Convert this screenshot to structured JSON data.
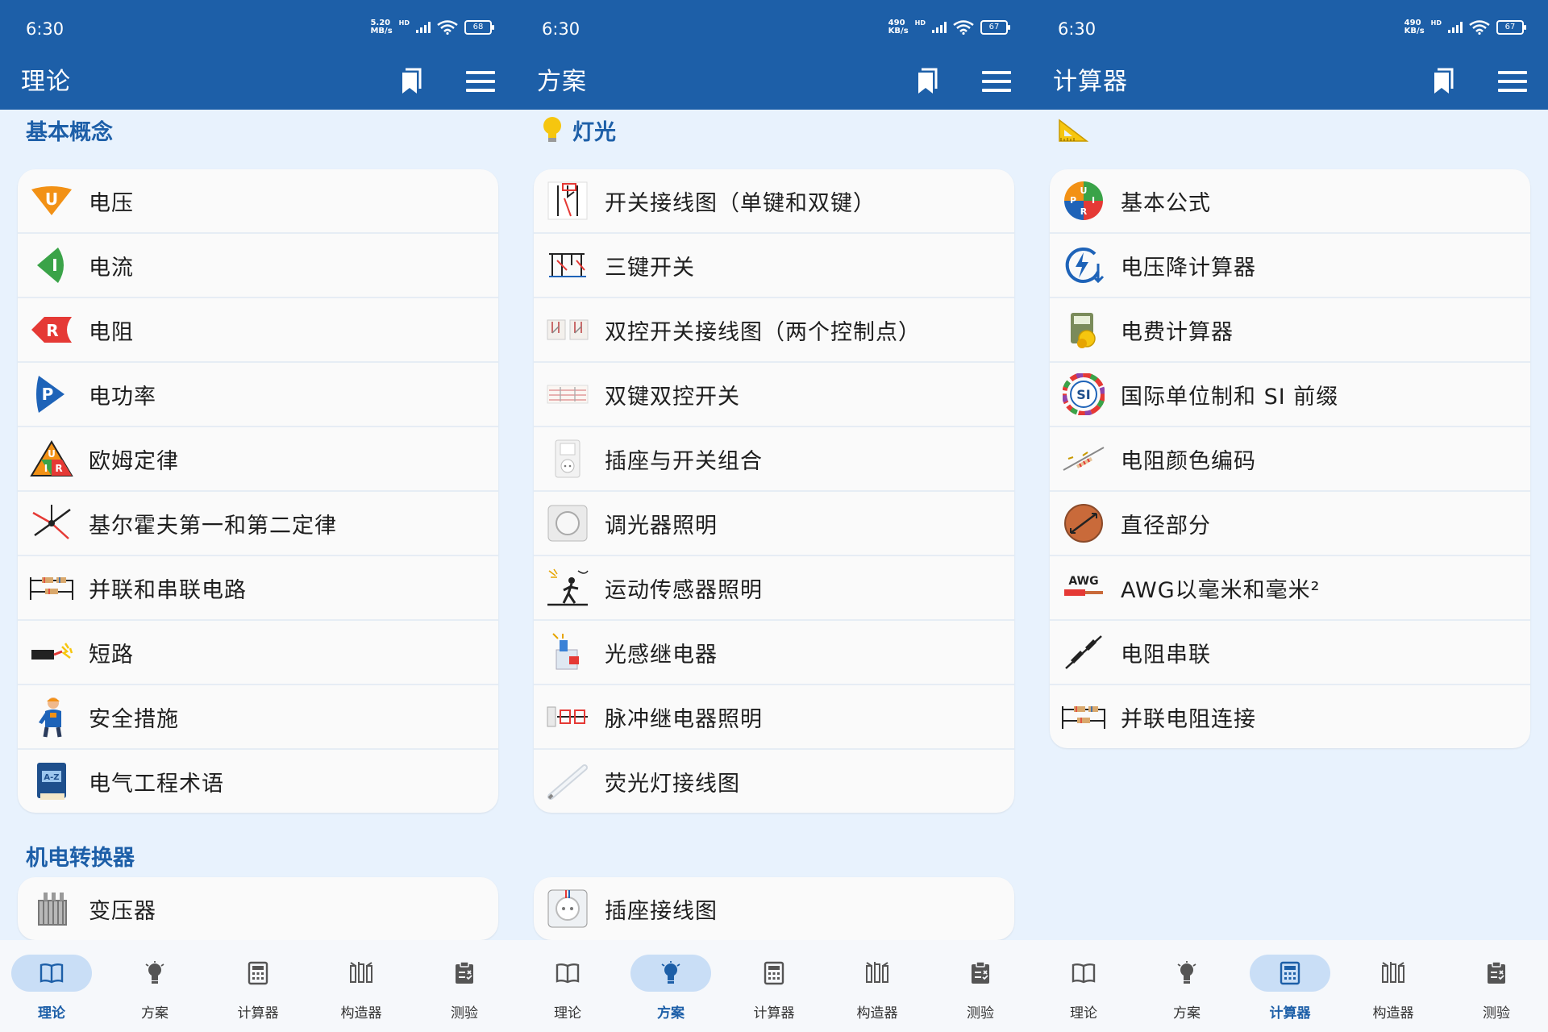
{
  "status": {
    "time": "6:30"
  },
  "screens": [
    {
      "speed": [
        "5.20",
        "MB/s"
      ],
      "battery": "68",
      "title": "理论",
      "sections": [
        {
          "title": "基本概念",
          "icon": "",
          "items": [
            {
              "label": "电压",
              "icon": "voltage-u-icon"
            },
            {
              "label": "电流",
              "icon": "current-i-icon"
            },
            {
              "label": "电阻",
              "icon": "resistance-r-icon"
            },
            {
              "label": "电功率",
              "icon": "power-p-icon"
            },
            {
              "label": "欧姆定律",
              "icon": "ohms-law-triangle-icon"
            },
            {
              "label": "基尔霍夫第一和第二定律",
              "icon": "kirchhoff-node-icon"
            },
            {
              "label": "并联和串联电路",
              "icon": "parallel-series-circuit-icon"
            },
            {
              "label": "短路",
              "icon": "short-circuit-spark-icon"
            },
            {
              "label": "安全措施",
              "icon": "electrician-worker-icon"
            },
            {
              "label": "电气工程术语",
              "icon": "az-book-icon"
            }
          ]
        },
        {
          "title": "机电转换器",
          "icon": "",
          "items": [
            {
              "label": "变压器",
              "icon": "transformer-icon"
            }
          ]
        }
      ]
    },
    {
      "speed": [
        "490",
        "KB/s"
      ],
      "battery": "67",
      "title": "方案",
      "sections": [
        {
          "title": "灯光",
          "icon": "lightbulb-icon",
          "items": [
            {
              "label": "开关接线图（单键和双键）",
              "icon": "switch-wiring-icon"
            },
            {
              "label": "三键开关",
              "icon": "three-gang-switch-icon"
            },
            {
              "label": "双控开关接线图（两个控制点）",
              "icon": "two-way-switch-icon"
            },
            {
              "label": "双键双控开关",
              "icon": "double-two-way-switch-icon"
            },
            {
              "label": "插座与开关组合",
              "icon": "socket-switch-combo-icon"
            },
            {
              "label": "调光器照明",
              "icon": "dimmer-icon"
            },
            {
              "label": "运动传感器照明",
              "icon": "motion-sensor-icon"
            },
            {
              "label": "光感继电器",
              "icon": "photo-relay-icon"
            },
            {
              "label": "脉冲继电器照明",
              "icon": "impulse-relay-icon"
            },
            {
              "label": "荧光灯接线图",
              "icon": "fluorescent-tube-icon"
            }
          ]
        },
        {
          "title": "",
          "icon": "",
          "items": [
            {
              "label": "插座接线图",
              "icon": "socket-outlet-icon"
            }
          ]
        }
      ]
    },
    {
      "speed": [
        "490",
        "KB/s"
      ],
      "battery": "67",
      "title": "计算器",
      "sections": [
        {
          "title": "",
          "icon": "set-square-ruler-icon",
          "items": [
            {
              "label": "基本公式",
              "icon": "puri-wheel-icon"
            },
            {
              "label": "电压降计算器",
              "icon": "voltage-drop-icon"
            },
            {
              "label": "电费计算器",
              "icon": "electricity-bill-icon"
            },
            {
              "label": "国际单位制和 SI 前缀",
              "icon": "si-units-icon"
            },
            {
              "label": "电阻颜色编码",
              "icon": "resistor-color-code-icon"
            },
            {
              "label": "直径部分",
              "icon": "wire-diameter-icon"
            },
            {
              "label": "AWG以毫米和毫米²",
              "icon": "awg-wire-icon"
            },
            {
              "label": "电阻串联",
              "icon": "resistors-series-icon"
            },
            {
              "label": "并联电阻连接",
              "icon": "resistors-parallel-icon"
            }
          ]
        }
      ]
    }
  ],
  "nav": [
    {
      "label": "理论",
      "icon": "book-icon"
    },
    {
      "label": "方案",
      "icon": "lightbulb-icon"
    },
    {
      "label": "计算器",
      "icon": "calculator-icon"
    },
    {
      "label": "构造器",
      "icon": "constructor-icon"
    },
    {
      "label": "测验",
      "icon": "quiz-clipboard-icon"
    }
  ],
  "nav_active": [
    0,
    1,
    2
  ],
  "colors": {
    "appbar": "#1d5fa8",
    "background": "#e8f2fd",
    "accent": "#1d5fa8",
    "active_pill": "#c9def6"
  }
}
